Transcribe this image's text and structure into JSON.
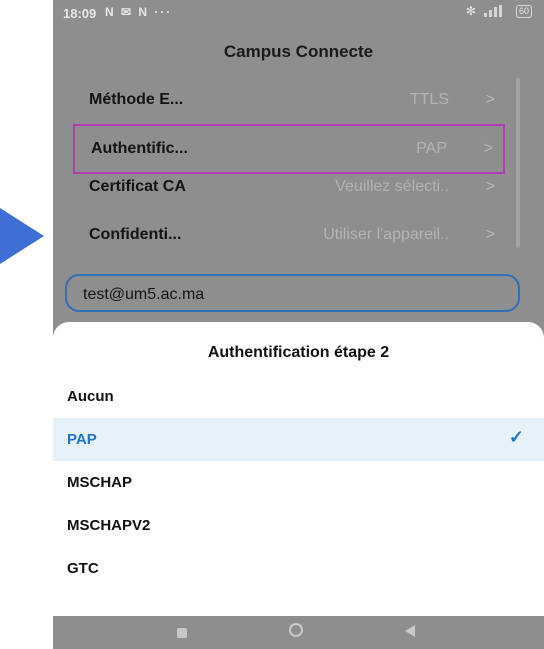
{
  "status": {
    "time": "18:09",
    "left_icons": "N ✉ N ···",
    "battery": "60"
  },
  "screen_title": "Campus Connecte",
  "settings": [
    {
      "label": "Méthode E...",
      "value": "TTLS"
    },
    {
      "label": "Authentific...",
      "value": "PAP"
    },
    {
      "label": "Certificat CA",
      "value": "Veuillez sélecti.."
    },
    {
      "label": "Confidenti...",
      "value": "Utiliser l'appareil.."
    }
  ],
  "identity_value": "test@um5.ac.ma",
  "sheet": {
    "title": "Authentification étape 2",
    "options": [
      "Aucun",
      "PAP",
      "MSCHAP",
      "MSCHAPV2",
      "GTC"
    ],
    "selected": "PAP"
  },
  "colors": {
    "highlight_border": "#b03cb3",
    "accent": "#1e73d1",
    "arrow": "#3f6fd6"
  }
}
